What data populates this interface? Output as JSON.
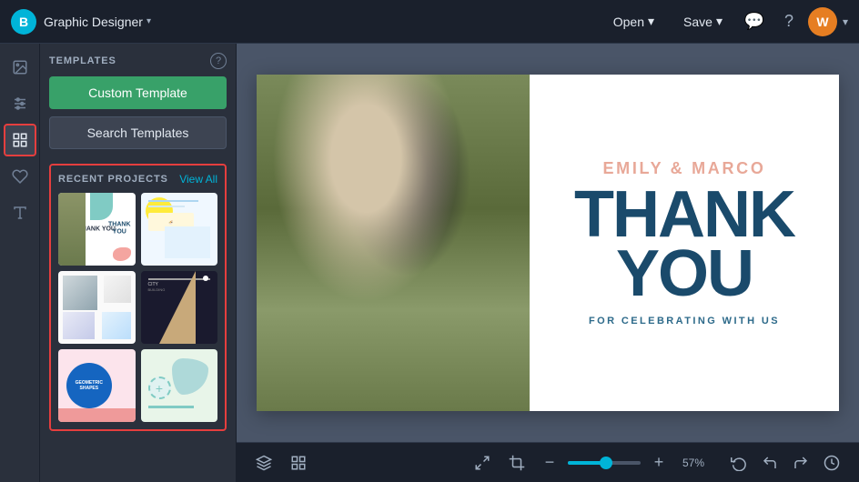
{
  "app": {
    "logo_text": "B",
    "brand": "Graphic Designer",
    "brand_chevron": "▾"
  },
  "topbar": {
    "open_label": "Open",
    "open_chevron": "▾",
    "save_label": "Save",
    "save_chevron": "▾",
    "chat_icon": "💬",
    "help_icon": "?",
    "avatar_initial": "W",
    "avatar_chevron": "▾"
  },
  "sidebar_icons": [
    {
      "name": "image-icon",
      "icon": "🖼",
      "active": false
    },
    {
      "name": "sliders-icon",
      "icon": "⊞",
      "active": false
    },
    {
      "name": "templates-icon",
      "icon": "⊟",
      "active": true
    },
    {
      "name": "heart-icon",
      "icon": "♡",
      "active": false
    },
    {
      "name": "text-icon",
      "icon": "A",
      "active": false
    }
  ],
  "panel": {
    "title": "TEMPLATES",
    "help_label": "?",
    "custom_template_btn": "Custom Template",
    "search_templates_btn": "Search Templates",
    "recent_title": "RECENT PROJECTS",
    "view_all_label": "View All",
    "templates": [
      {
        "id": "t1",
        "type": "thank-you-wedding"
      },
      {
        "id": "t2",
        "type": "food-menu"
      },
      {
        "id": "t3",
        "type": "social-collage"
      },
      {
        "id": "t4",
        "type": "geometric-brown"
      },
      {
        "id": "t5",
        "type": "geometric-shapes"
      },
      {
        "id": "t6",
        "type": "light-blue"
      }
    ]
  },
  "canvas": {
    "names": "EMILY & MARCO",
    "headline_line1": "THANK",
    "headline_line2": "YOU",
    "subtext": "FOR CELEBRATING WITH US"
  },
  "bottom_toolbar": {
    "layers_icon": "⊛",
    "grid_icon": "⊞",
    "resize_icon": "⤢",
    "crop_icon": "⊡",
    "zoom_minus": "−",
    "zoom_plus": "+",
    "zoom_percent": "57%",
    "undo_icon": "↺",
    "redo_icon": "↻",
    "clock_icon": "⊙",
    "zoom_value": 57
  }
}
